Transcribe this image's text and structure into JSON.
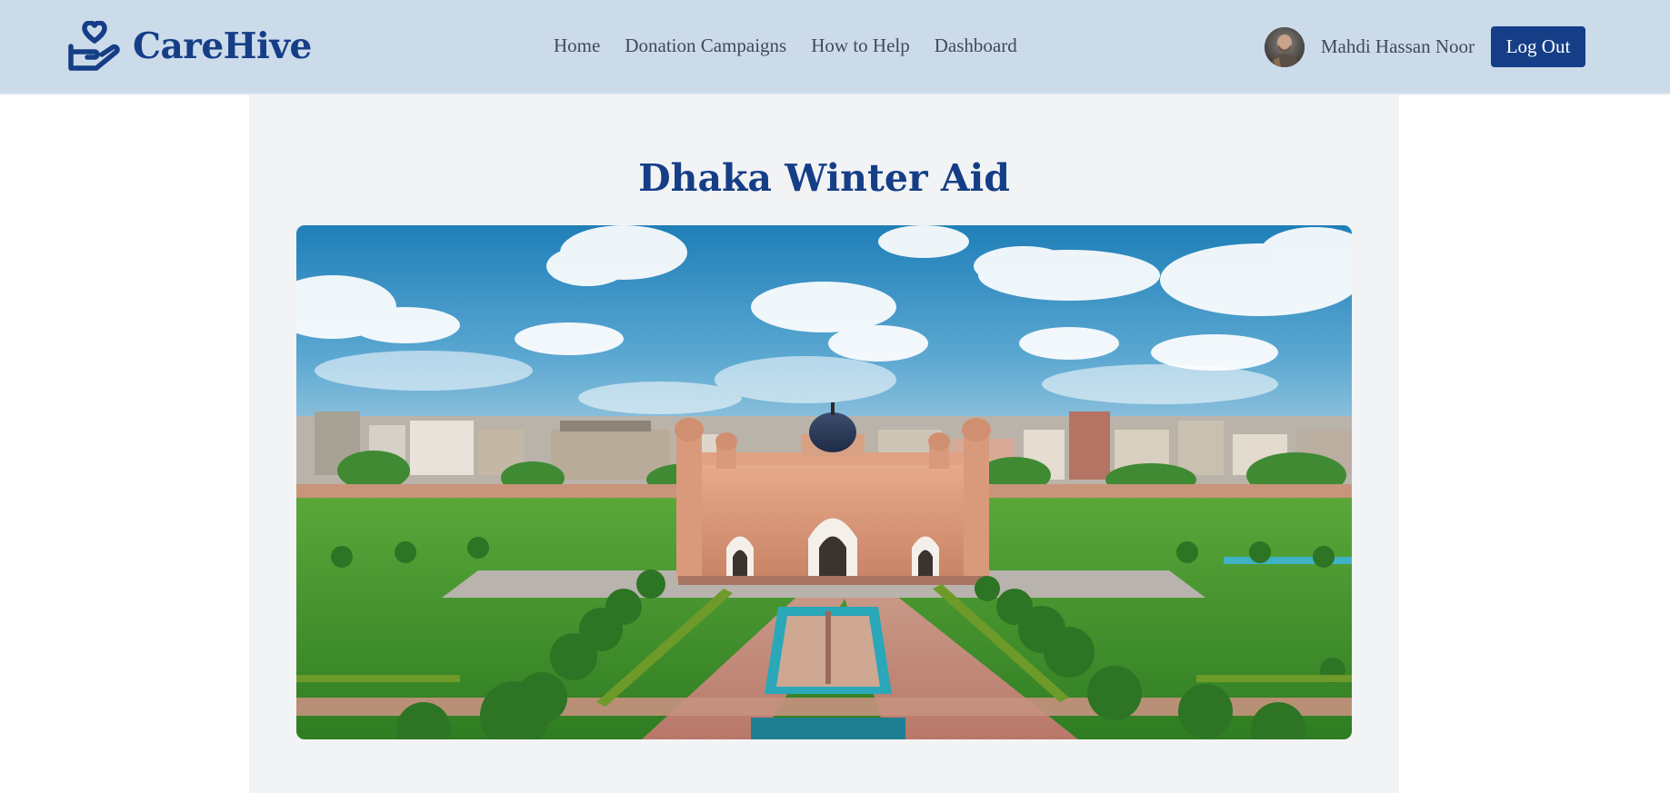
{
  "brand": {
    "name": "CareHive",
    "icon": "hand-heart-icon",
    "color": "#153e87"
  },
  "nav": {
    "links": [
      {
        "label": "Home"
      },
      {
        "label": "Donation Campaigns"
      },
      {
        "label": "How to Help"
      },
      {
        "label": "Dashboard"
      }
    ]
  },
  "user": {
    "name": "Mahdi Hassan Noor",
    "logout_label": "Log Out"
  },
  "campaign": {
    "title": "Dhaka Winter Aid",
    "image_subject": "Lalbagh Fort mausoleum with gardens and city skyline"
  },
  "colors": {
    "navbar_bg": "#cbdbea",
    "accent": "#153e87",
    "card_bg": "#f2f3f5"
  }
}
